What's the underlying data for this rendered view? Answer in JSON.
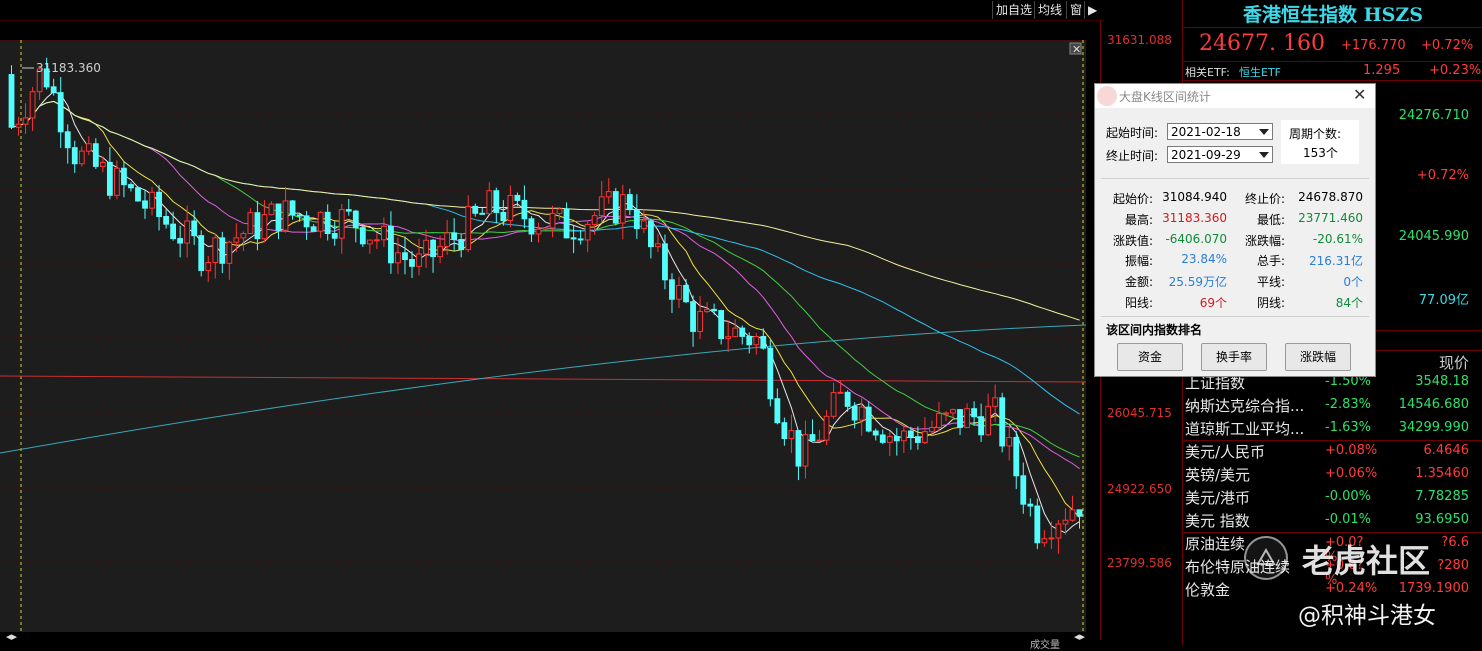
{
  "toolbar": {
    "add_watch": "加自选",
    "ma_lines": "均线",
    "window": "窗"
  },
  "chart": {
    "peak_label": "31183.360",
    "y_ticks": [
      "31631.088",
      "26045.715",
      "24922.650",
      "23799.586"
    ],
    "colors": {
      "up": "#ff3232",
      "down": "#54fcfc",
      "bg": "#1d1d1d"
    }
  },
  "chart_data": {
    "type": "candlestick",
    "period_start": "2021-02-18",
    "period_end": "2021-09-29",
    "bars": 153,
    "open": 31084.94,
    "close": 24678.87,
    "high": 31183.36,
    "low": 23771.46,
    "moving_averages": [
      "MA5",
      "MA10",
      "MA20",
      "MA30",
      "MA60",
      "MA120",
      "MA250"
    ]
  },
  "quote": {
    "title": "香港恒生指数 HSZS",
    "price": "24677. 160",
    "change": "+176.770",
    "change_pct": "+0.72%",
    "etf_label": "相关ETF:",
    "etf_name": "恒生ETF",
    "etf_price": "1.295",
    "etf_pct": "+0.23%",
    "side_values": [
      "24276.710",
      "+0.72%",
      "24045.990",
      "77.09亿"
    ],
    "header_now": "现价"
  },
  "dialog": {
    "title": "大盘K线区间统计",
    "start_label": "起始时间:",
    "end_label": "终止时间:",
    "start_value": "2021-02-18",
    "end_value": "2021-09-29",
    "period_count_label": "周期个数:",
    "period_count_value": "153个",
    "stats": {
      "open_label": "起始价:",
      "open": "31084.940",
      "close_label": "终止价:",
      "close": "24678.870",
      "high_label": "最高:",
      "high": "31183.360",
      "low_label": "最低:",
      "low": "23771.460",
      "chg_label": "涨跌值:",
      "chg": "-6406.070",
      "chg_pct_label": "涨跌幅:",
      "chg_pct": "-20.61%",
      "amp_label": "振幅:",
      "amp": "23.84%",
      "vol_label": "总手:",
      "vol": "216.31亿",
      "amount_label": "金额:",
      "amount": "25.59万亿",
      "flat_label": "平线:",
      "flat": "0个",
      "yang_label": "阳线:",
      "yang": "69个",
      "yin_label": "阴线:",
      "yin": "84个"
    },
    "rank_title": "该区间内指数排名",
    "btn_fund": "资金",
    "btn_turnover": "换手率",
    "btn_change": "涨跌幅"
  },
  "quotes": [
    {
      "name": "上证指数",
      "chg": "-1.50%",
      "px": "3548.18",
      "dir": "down"
    },
    {
      "name": "纳斯达克综合指...",
      "chg": "-2.83%",
      "px": "14546.680",
      "dir": "down"
    },
    {
      "name": "道琼斯工业平均...",
      "chg": "-1.63%",
      "px": "34299.990",
      "dir": "down"
    },
    {
      "name": "美元/人民币",
      "chg": "+0.08%",
      "px": "6.4646",
      "dir": "up"
    },
    {
      "name": "英镑/美元",
      "chg": "+0.06%",
      "px": "1.35460",
      "dir": "up"
    },
    {
      "name": "美元/港币",
      "chg": "-0.00%",
      "px": "7.78285",
      "dir": "down"
    },
    {
      "name": "美元 指数",
      "chg": "-0.01%",
      "px": "93.6950",
      "dir": "down"
    },
    {
      "name": "原油连续",
      "chg": "+0.0?%",
      "px": "?6.6",
      "dir": "up"
    },
    {
      "name": "布伦特原油连续",
      "chg": "+0.0?%",
      "px": "?280",
      "dir": "up"
    },
    {
      "name": "伦敦金",
      "chg": "+0.24%",
      "px": "1739.1900",
      "dir": "up"
    }
  ],
  "watermark": {
    "brand": "老虎社区",
    "author": "@积神斗港女"
  },
  "bottom_label": "成交量"
}
